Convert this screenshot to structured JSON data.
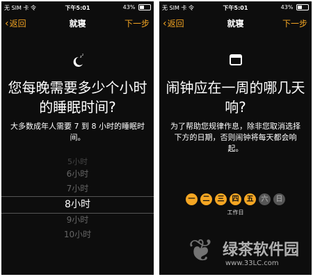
{
  "screens": [
    {
      "status": {
        "carrier": "无 SIM 卡 令",
        "time": "下午5:01",
        "battery": "43%"
      },
      "nav": {
        "back": "返回",
        "title": "就寝",
        "next": "下一步"
      },
      "icon": "moon-icon",
      "heading": "您每晚需要多少个小时的睡眠时间?",
      "description": "大多数成年人需要 7 到 8 小时的睡眠时间。",
      "picker": {
        "faint": "5小时",
        "options": [
          "6小时",
          "7小时",
          "8小时",
          "9小时",
          "10小时"
        ],
        "selected": "8小时"
      }
    },
    {
      "status": {
        "carrier": "无 SIM 卡 令",
        "time": "下午5:01",
        "battery": "43%"
      },
      "nav": {
        "back": "返回",
        "title": "就寝",
        "next": "下一步"
      },
      "icon": "calendar-icon",
      "heading": "闹钟应在一周的哪几天响?",
      "description": "为了帮助您规律作息，除非您取消选择下方的日期，否则闹钟将每天都会响起。",
      "days": [
        "一",
        "二",
        "三",
        "四",
        "五",
        "六",
        "日"
      ],
      "days_selected": [
        "一",
        "二",
        "三",
        "四",
        "五"
      ],
      "days_caption": "工作日"
    }
  ],
  "watermark": {
    "title": "绿茶软件园",
    "url": "www.33LC.com"
  },
  "colors": {
    "accent": "#f5a623",
    "background": "#0d0d0d"
  }
}
